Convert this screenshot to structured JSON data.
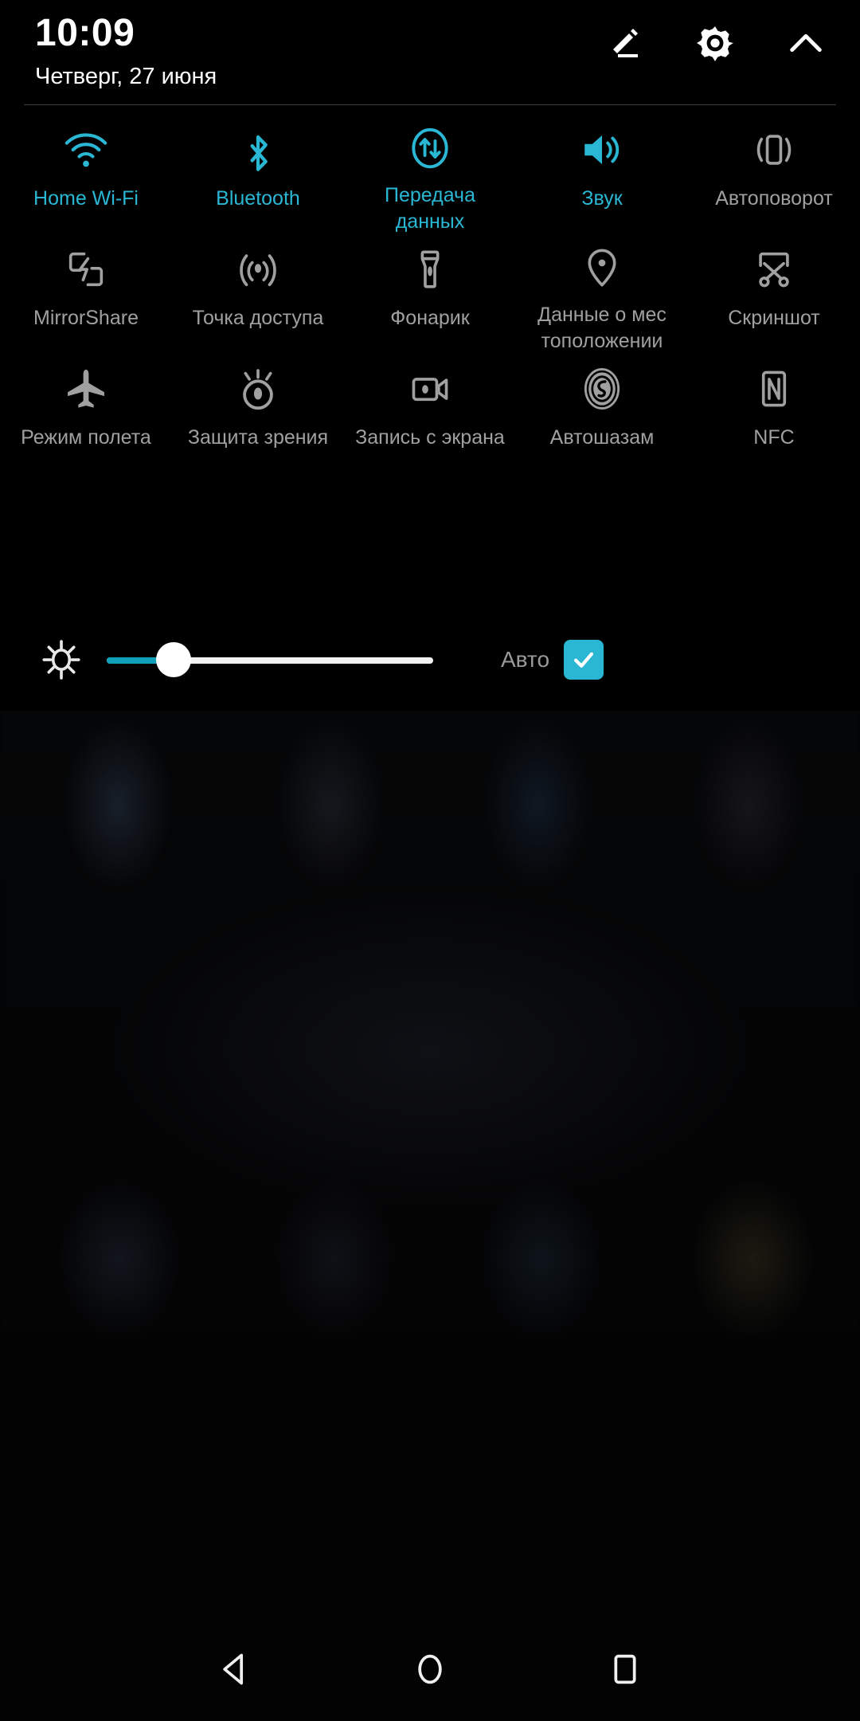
{
  "status_bar": {
    "time": "10:09",
    "date": "Четверг, 27 июня"
  },
  "header_actions": [
    {
      "name": "edit-icon",
      "label": "Edit"
    },
    {
      "name": "settings-gear-icon",
      "label": "Settings"
    },
    {
      "name": "chevron-up-icon",
      "label": "Collapse"
    }
  ],
  "colors": {
    "accent": "#2ab7d4",
    "inactive": "#a0a0a0",
    "slider_fill": "#0f9fb8",
    "background": "#000000"
  },
  "tiles": [
    [
      {
        "icon": "wifi-icon",
        "label": "Home Wi-Fi",
        "active": true
      },
      {
        "icon": "bluetooth-icon",
        "label": "Bluetooth",
        "active": true
      },
      {
        "icon": "mobile-data-icon",
        "label": "Передача данных",
        "active": true
      },
      {
        "icon": "sound-icon",
        "label": "Звук",
        "active": true
      },
      {
        "icon": "auto-rotate-icon",
        "label": "Автоповорот",
        "active": false
      }
    ],
    [
      {
        "icon": "mirrorshare-icon",
        "label": "MirrorShare",
        "active": false
      },
      {
        "icon": "hotspot-icon",
        "label": "Точка доступа",
        "active": false
      },
      {
        "icon": "flashlight-icon",
        "label": "Фонарик",
        "active": false
      },
      {
        "icon": "location-pin-icon",
        "label": "Данные о мес тоположении",
        "active": false
      },
      {
        "icon": "screenshot-icon",
        "label": "Скриншот",
        "active": false
      }
    ],
    [
      {
        "icon": "airplane-icon",
        "label": "Режим полета",
        "active": false
      },
      {
        "icon": "eye-comfort-icon",
        "label": "Защита зрения",
        "active": false
      },
      {
        "icon": "screen-record-icon",
        "label": "Запись с экрана",
        "active": false
      },
      {
        "icon": "shazam-icon",
        "label": "Автошазам",
        "active": false
      },
      {
        "icon": "nfc-icon",
        "label": "NFC",
        "active": false
      }
    ]
  ],
  "brightness": {
    "icon": "brightness-icon",
    "value_percent": 21,
    "auto_label": "Авто",
    "auto_checked": true
  },
  "navigation_bar": [
    {
      "icon": "back-icon",
      "label": "Back"
    },
    {
      "icon": "home-icon",
      "label": "Home"
    },
    {
      "icon": "recents-icon",
      "label": "Recents"
    }
  ]
}
